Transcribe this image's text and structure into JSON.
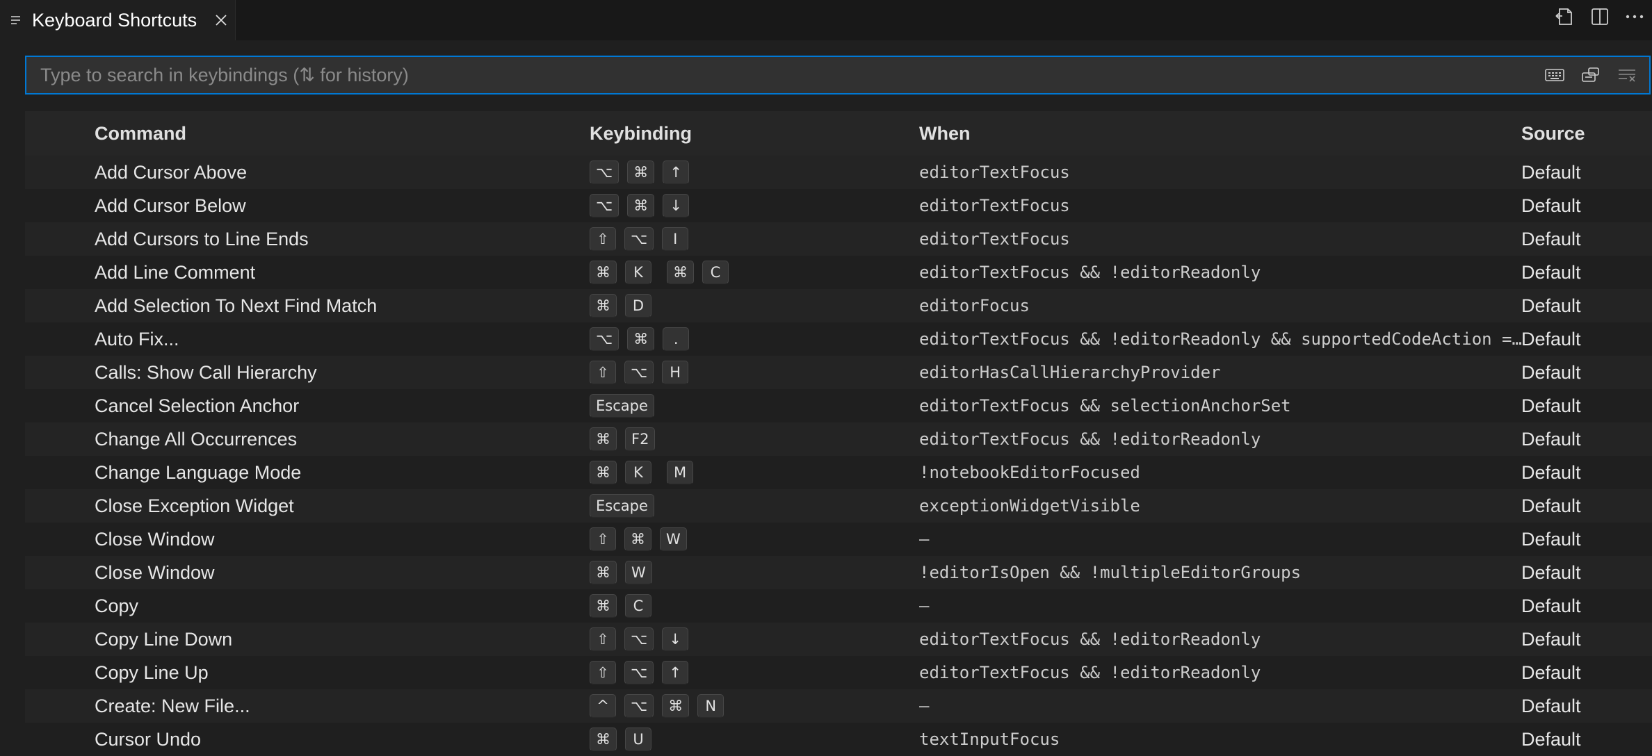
{
  "tab": {
    "title": "Keyboard Shortcuts"
  },
  "search": {
    "placeholder": "Type to search in keybindings (⇅ for history)"
  },
  "headers": {
    "command": "Command",
    "keybinding": "Keybinding",
    "when": "When",
    "source": "Source"
  },
  "rows": [
    {
      "command": "Add Cursor Above",
      "keys": [
        [
          "⌥",
          "⌘",
          "↑"
        ]
      ],
      "when": "editorTextFocus",
      "source": "Default"
    },
    {
      "command": "Add Cursor Below",
      "keys": [
        [
          "⌥",
          "⌘",
          "↓"
        ]
      ],
      "when": "editorTextFocus",
      "source": "Default"
    },
    {
      "command": "Add Cursors to Line Ends",
      "keys": [
        [
          "⇧",
          "⌥",
          "I"
        ]
      ],
      "when": "editorTextFocus",
      "source": "Default"
    },
    {
      "command": "Add Line Comment",
      "keys": [
        [
          "⌘",
          "K"
        ],
        [
          "⌘",
          "C"
        ]
      ],
      "when": "editorTextFocus && !editorReadonly",
      "source": "Default"
    },
    {
      "command": "Add Selection To Next Find Match",
      "keys": [
        [
          "⌘",
          "D"
        ]
      ],
      "when": "editorFocus",
      "source": "Default"
    },
    {
      "command": "Auto Fix...",
      "keys": [
        [
          "⌥",
          "⌘",
          "."
        ]
      ],
      "when": "editorTextFocus && !editorReadonly && supportedCodeAction =~ /(\\s|^)quickfix\\b/",
      "source": "Default"
    },
    {
      "command": "Calls: Show Call Hierarchy",
      "keys": [
        [
          "⇧",
          "⌥",
          "H"
        ]
      ],
      "when": "editorHasCallHierarchyProvider",
      "source": "Default"
    },
    {
      "command": "Cancel Selection Anchor",
      "keys": [
        [
          "Escape"
        ]
      ],
      "when": "editorTextFocus && selectionAnchorSet",
      "source": "Default"
    },
    {
      "command": "Change All Occurrences",
      "keys": [
        [
          "⌘",
          "F2"
        ]
      ],
      "when": "editorTextFocus && !editorReadonly",
      "source": "Default"
    },
    {
      "command": "Change Language Mode",
      "keys": [
        [
          "⌘",
          "K"
        ],
        [
          "M"
        ]
      ],
      "when": "!notebookEditorFocused",
      "source": "Default"
    },
    {
      "command": "Close Exception Widget",
      "keys": [
        [
          "Escape"
        ]
      ],
      "when": "exceptionWidgetVisible",
      "source": "Default"
    },
    {
      "command": "Close Window",
      "keys": [
        [
          "⇧",
          "⌘",
          "W"
        ]
      ],
      "when": "–",
      "source": "Default"
    },
    {
      "command": "Close Window",
      "keys": [
        [
          "⌘",
          "W"
        ]
      ],
      "when": "!editorIsOpen && !multipleEditorGroups",
      "source": "Default"
    },
    {
      "command": "Copy",
      "keys": [
        [
          "⌘",
          "C"
        ]
      ],
      "when": "–",
      "source": "Default"
    },
    {
      "command": "Copy Line Down",
      "keys": [
        [
          "⇧",
          "⌥",
          "↓"
        ]
      ],
      "when": "editorTextFocus && !editorReadonly",
      "source": "Default"
    },
    {
      "command": "Copy Line Up",
      "keys": [
        [
          "⇧",
          "⌥",
          "↑"
        ]
      ],
      "when": "editorTextFocus && !editorReadonly",
      "source": "Default"
    },
    {
      "command": "Create: New File...",
      "keys": [
        [
          "^",
          "⌥",
          "⌘",
          "N"
        ]
      ],
      "when": "–",
      "source": "Default"
    },
    {
      "command": "Cursor Undo",
      "keys": [
        [
          "⌘",
          "U"
        ]
      ],
      "when": "textInputFocus",
      "source": "Default"
    }
  ]
}
